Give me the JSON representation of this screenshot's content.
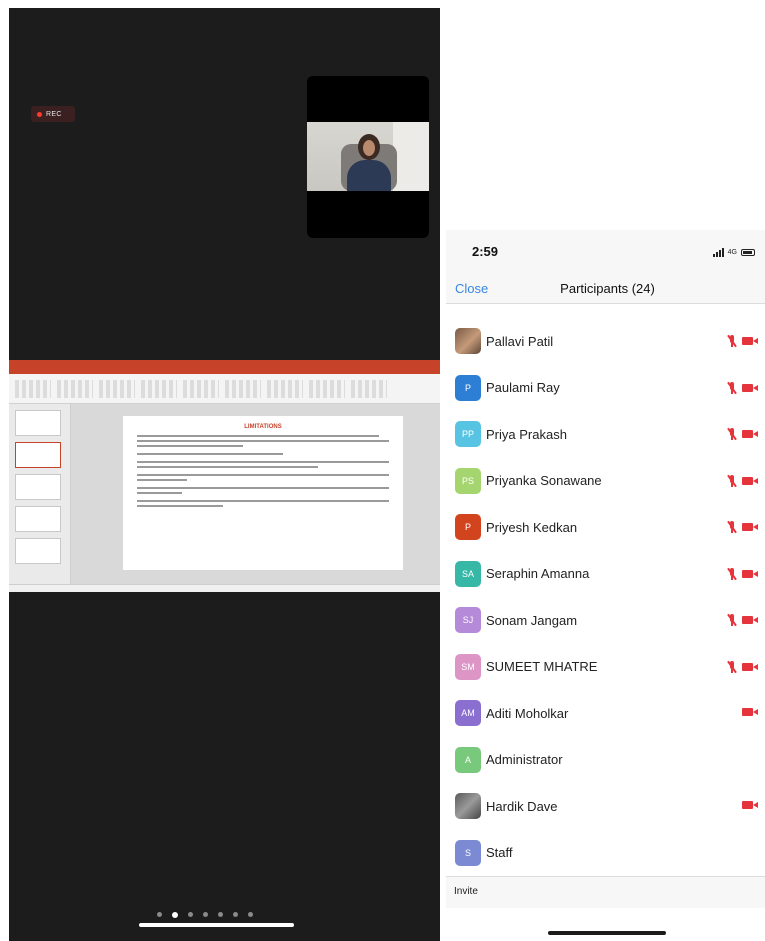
{
  "meeting": {
    "recording_label": "REC",
    "presentation": {
      "slide_title": "LIMITATIONS"
    },
    "pages": {
      "count": 7,
      "active_index": 1
    }
  },
  "status_bar": {
    "time": "2:59",
    "network": "4G"
  },
  "participants_panel": {
    "close_label": "Close",
    "title": "Participants (24)",
    "invite_label": "Invite",
    "participants": [
      {
        "name": "Pallavi Patil",
        "initials": "",
        "avatar_color": "",
        "avatar_type": "photo",
        "mic_muted": true,
        "video_off": true
      },
      {
        "name": "Paulami Ray",
        "initials": "P",
        "avatar_color": "#2d7fd6",
        "avatar_type": "initials",
        "mic_muted": true,
        "video_off": true
      },
      {
        "name": "Priya Prakash",
        "initials": "PP",
        "avatar_color": "#58c4e3",
        "avatar_type": "initials",
        "mic_muted": true,
        "video_off": true
      },
      {
        "name": "Priyanka Sonawane",
        "initials": "PS",
        "avatar_color": "#a4d56f",
        "avatar_type": "initials",
        "mic_muted": true,
        "video_off": true
      },
      {
        "name": "Priyesh Kedkan",
        "initials": "P",
        "avatar_color": "#d2441e",
        "avatar_type": "initials",
        "mic_muted": true,
        "video_off": true
      },
      {
        "name": "Seraphin Amanna",
        "initials": "SA",
        "avatar_color": "#37b8a6",
        "avatar_type": "initials",
        "mic_muted": true,
        "video_off": true
      },
      {
        "name": "Sonam Jangam",
        "initials": "SJ",
        "avatar_color": "#b58ad9",
        "avatar_type": "initials",
        "mic_muted": true,
        "video_off": true
      },
      {
        "name": "SUMEET MHATRE",
        "initials": "SM",
        "avatar_color": "#dd95c6",
        "avatar_type": "initials",
        "mic_muted": true,
        "video_off": true
      },
      {
        "name": "Aditi Moholkar",
        "initials": "AM",
        "avatar_color": "#8a6fd1",
        "avatar_type": "initials",
        "mic_muted": false,
        "video_off": true
      },
      {
        "name": "Administrator",
        "initials": "A",
        "avatar_color": "#79c97c",
        "avatar_type": "initials",
        "mic_muted": false,
        "video_off": false
      },
      {
        "name": "Hardik Dave",
        "initials": "",
        "avatar_color": "",
        "avatar_type": "photo2",
        "mic_muted": false,
        "video_off": true
      },
      {
        "name": "Staff",
        "initials": "S",
        "avatar_color": "#7b8ad3",
        "avatar_type": "initials",
        "mic_muted": false,
        "video_off": false
      }
    ]
  }
}
